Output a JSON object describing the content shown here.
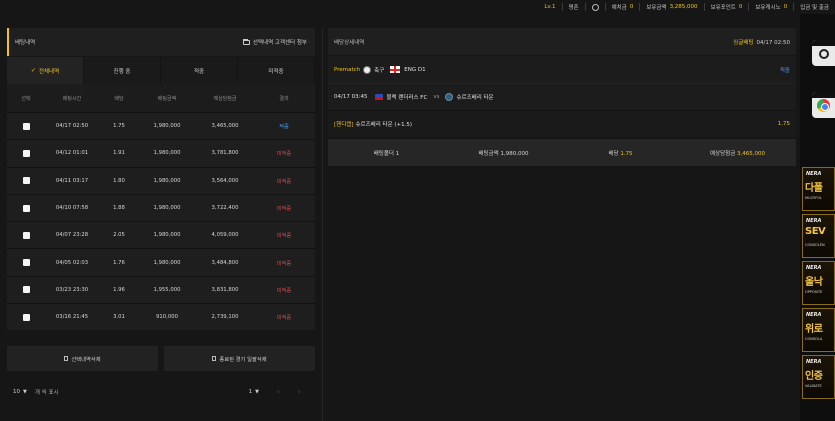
{
  "topbar": {
    "level": "Lv.1",
    "username": "명촌",
    "items": [
      {
        "label": "예치금",
        "value": "0"
      },
      {
        "label": "보유금액",
        "value": "3,285,000"
      },
      {
        "label": "보유포인트",
        "value": "0"
      },
      {
        "label": "보유캐시노",
        "value": "0"
      }
    ],
    "deposit_withdraw": "입금 및 출금"
  },
  "bets_panel": {
    "title": "배팅내역",
    "attach_link": "선택내역 고객센터 첨부",
    "tabs": [
      {
        "label": "전체내역",
        "active": true
      },
      {
        "label": "진행 중",
        "active": false
      },
      {
        "label": "적중",
        "active": false
      },
      {
        "label": "미적중",
        "active": false
      }
    ],
    "columns": [
      "선택",
      "배팅시간",
      "배당",
      "배팅금액",
      "예상당첨금",
      "결과"
    ],
    "rows": [
      {
        "time": "04/17 02:50",
        "odds": "1.75",
        "amount": "1,980,000",
        "expected": "3,465,000",
        "result": "적중",
        "status": "win"
      },
      {
        "time": "04/12 01:01",
        "odds": "1.91",
        "amount": "1,980,000",
        "expected": "3,781,800",
        "result": "미적중",
        "status": "miss"
      },
      {
        "time": "04/11 03:17",
        "odds": "1.80",
        "amount": "1,980,000",
        "expected": "3,564,000",
        "result": "미적중",
        "status": "miss"
      },
      {
        "time": "04/10 07:58",
        "odds": "1.88",
        "amount": "1,980,000",
        "expected": "3,722,400",
        "result": "미적중",
        "status": "miss"
      },
      {
        "time": "04/07 23:28",
        "odds": "2.05",
        "amount": "1,980,000",
        "expected": "4,059,000",
        "result": "미적중",
        "status": "miss"
      },
      {
        "time": "04/05 02:03",
        "odds": "1.76",
        "amount": "1,980,000",
        "expected": "3,484,800",
        "result": "미적중",
        "status": "miss"
      },
      {
        "time": "03/23 23:30",
        "odds": "1.96",
        "amount": "1,955,000",
        "expected": "3,831,800",
        "result": "미적중",
        "status": "miss"
      },
      {
        "time": "03/16 21:45",
        "odds": "3.01",
        "amount": "910,000",
        "expected": "2,739,100",
        "result": "미적중",
        "status": "miss"
      }
    ],
    "delete_selected": "선택내역삭제",
    "delete_finished": "종료된 경기 일괄삭제",
    "page_size": "10",
    "page_size_label": "개 씩 표시",
    "page": "1"
  },
  "detail_panel": {
    "title": "배당상세내역",
    "tag": "싱글배팅",
    "datetime": "04/17 02:50",
    "match_type": "Prematch",
    "sport": "축구",
    "league": "ENG D1",
    "status": "적중",
    "kickoff": "04/17 03:45",
    "home_team": "블랙 랜더러스 FC",
    "vs": "vs",
    "away_team": "슈르즈베리 타운",
    "pick_tag": "[핸디캡]",
    "pick_name": "슈르즈베리 타운 (+1.5)",
    "pick_odds": "1.75",
    "summary": {
      "folder_label": "배팅폴더",
      "folder_value": "1",
      "amount_label": "배팅금액",
      "amount_value": "1,980,000",
      "odds_label": "배당",
      "odds_value": "1.75",
      "expected_label": "예상당첨금",
      "expected_value": "3,465,000"
    }
  },
  "side_promos": [
    {
      "logo": "NERA",
      "main": "다폴",
      "sub": "MULTIFOL"
    },
    {
      "logo": "NERA",
      "main": "SEV",
      "sub": "CONSOLEN"
    },
    {
      "logo": "NERA",
      "main": "올낙",
      "sub": "OPPOSITE"
    },
    {
      "logo": "NERA",
      "main": "위로",
      "sub": "CONSOLA"
    },
    {
      "logo": "NERA",
      "main": "인증",
      "sub": "VALIDATE"
    }
  ],
  "colors": {
    "accent": "#f0c419",
    "win": "#4aa3ff",
    "miss": "#e04a4a",
    "bg": "#161616"
  }
}
